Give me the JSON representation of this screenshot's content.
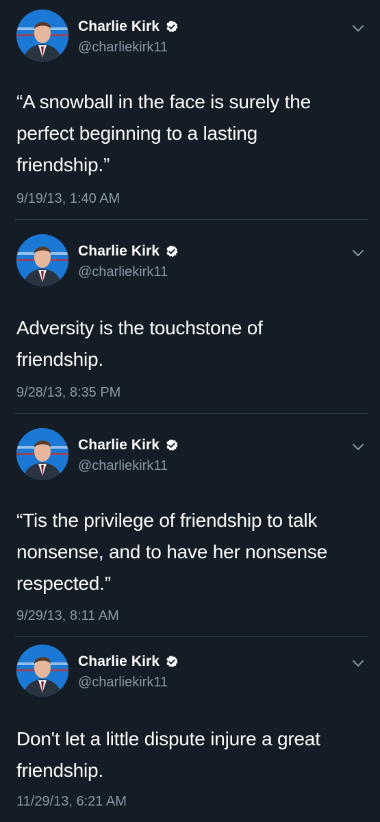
{
  "colors": {
    "background": "#141d26",
    "divider": "#2b3a49",
    "secondary_text": "#8899a6",
    "avatar_bg": "#1b78d4"
  },
  "icons": {
    "verified": "verified-badge-icon",
    "menu": "chevron-down-icon",
    "avatar": "profile-photo"
  },
  "tweets": [
    {
      "author": {
        "name": "Charlie Kirk",
        "handle": "@charliekirk11"
      },
      "lines": [
        "“A snowball in the face is surely the",
        "perfect beginning to a lasting",
        "friendship.”"
      ],
      "timestamp": "9/19/13, 1:40 AM"
    },
    {
      "author": {
        "name": "Charlie Kirk",
        "handle": "@charliekirk11"
      },
      "lines": [
        "Adversity is the touchstone of",
        "friendship."
      ],
      "timestamp": "9/28/13, 8:35 PM"
    },
    {
      "author": {
        "name": "Charlie Kirk",
        "handle": "@charliekirk11"
      },
      "lines": [
        "“Tis the privilege of friendship to talk",
        "nonsense, and to have her nonsense",
        "respected.”"
      ],
      "timestamp": "9/29/13, 8:11 AM"
    },
    {
      "author": {
        "name": "Charlie Kirk",
        "handle": "@charliekirk11"
      },
      "lines": [
        "Don't let a little dispute injure a great",
        "friendship."
      ],
      "timestamp": "11/29/13, 6:21 AM"
    }
  ]
}
